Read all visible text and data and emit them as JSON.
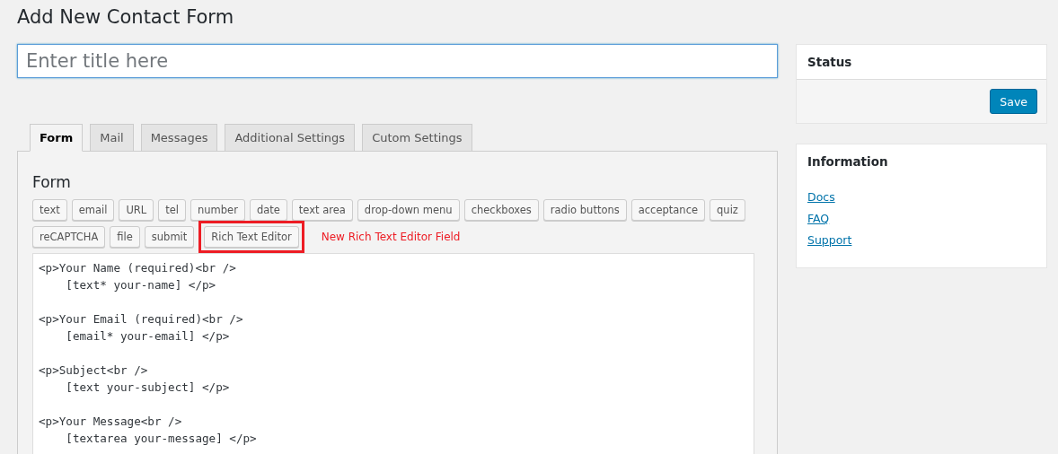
{
  "page_title": "Add New Contact Form",
  "title_field": {
    "placeholder": "Enter title here"
  },
  "tabs": [
    {
      "label": "Form",
      "selected": true
    },
    {
      "label": "Mail",
      "selected": false
    },
    {
      "label": "Messages",
      "selected": false
    },
    {
      "label": "Additional Settings",
      "selected": false
    },
    {
      "label": "Cutom Settings",
      "selected": false
    }
  ],
  "form_panel": {
    "heading": "Form",
    "tag_buttons": [
      {
        "label": "text",
        "highlighted": false
      },
      {
        "label": "email",
        "highlighted": false
      },
      {
        "label": "URL",
        "highlighted": false
      },
      {
        "label": "tel",
        "highlighted": false
      },
      {
        "label": "number",
        "highlighted": false
      },
      {
        "label": "date",
        "highlighted": false
      },
      {
        "label": "text area",
        "highlighted": false
      },
      {
        "label": "drop-down menu",
        "highlighted": false
      },
      {
        "label": "checkboxes",
        "highlighted": false
      },
      {
        "label": "radio buttons",
        "highlighted": false
      },
      {
        "label": "acceptance",
        "highlighted": false
      },
      {
        "label": "quiz",
        "highlighted": false
      },
      {
        "label": "reCAPTCHA",
        "highlighted": false
      },
      {
        "label": "file",
        "highlighted": false
      },
      {
        "label": "submit",
        "highlighted": false
      },
      {
        "label": "Rich Text Editor",
        "highlighted": true
      }
    ],
    "annotation": "New Rich Text Editor Field",
    "code_paragraphs": [
      {
        "lines": [
          "<p>Your Name (required)<br />",
          "    [text* your-name] </p>"
        ]
      },
      {
        "lines": [
          "<p>Your Email (required)<br />",
          "    [email* your-email] </p>"
        ]
      },
      {
        "lines": [
          "<p>Subject<br />",
          "    [text your-subject] </p>"
        ]
      },
      {
        "lines": [
          "<p>Your Message<br />",
          "    [textarea your-message] </p>"
        ]
      }
    ]
  },
  "sidebar": {
    "status": {
      "title": "Status",
      "save_button": "Save"
    },
    "information": {
      "title": "Information",
      "links": [
        "Docs",
        "FAQ",
        "Support"
      ]
    }
  }
}
